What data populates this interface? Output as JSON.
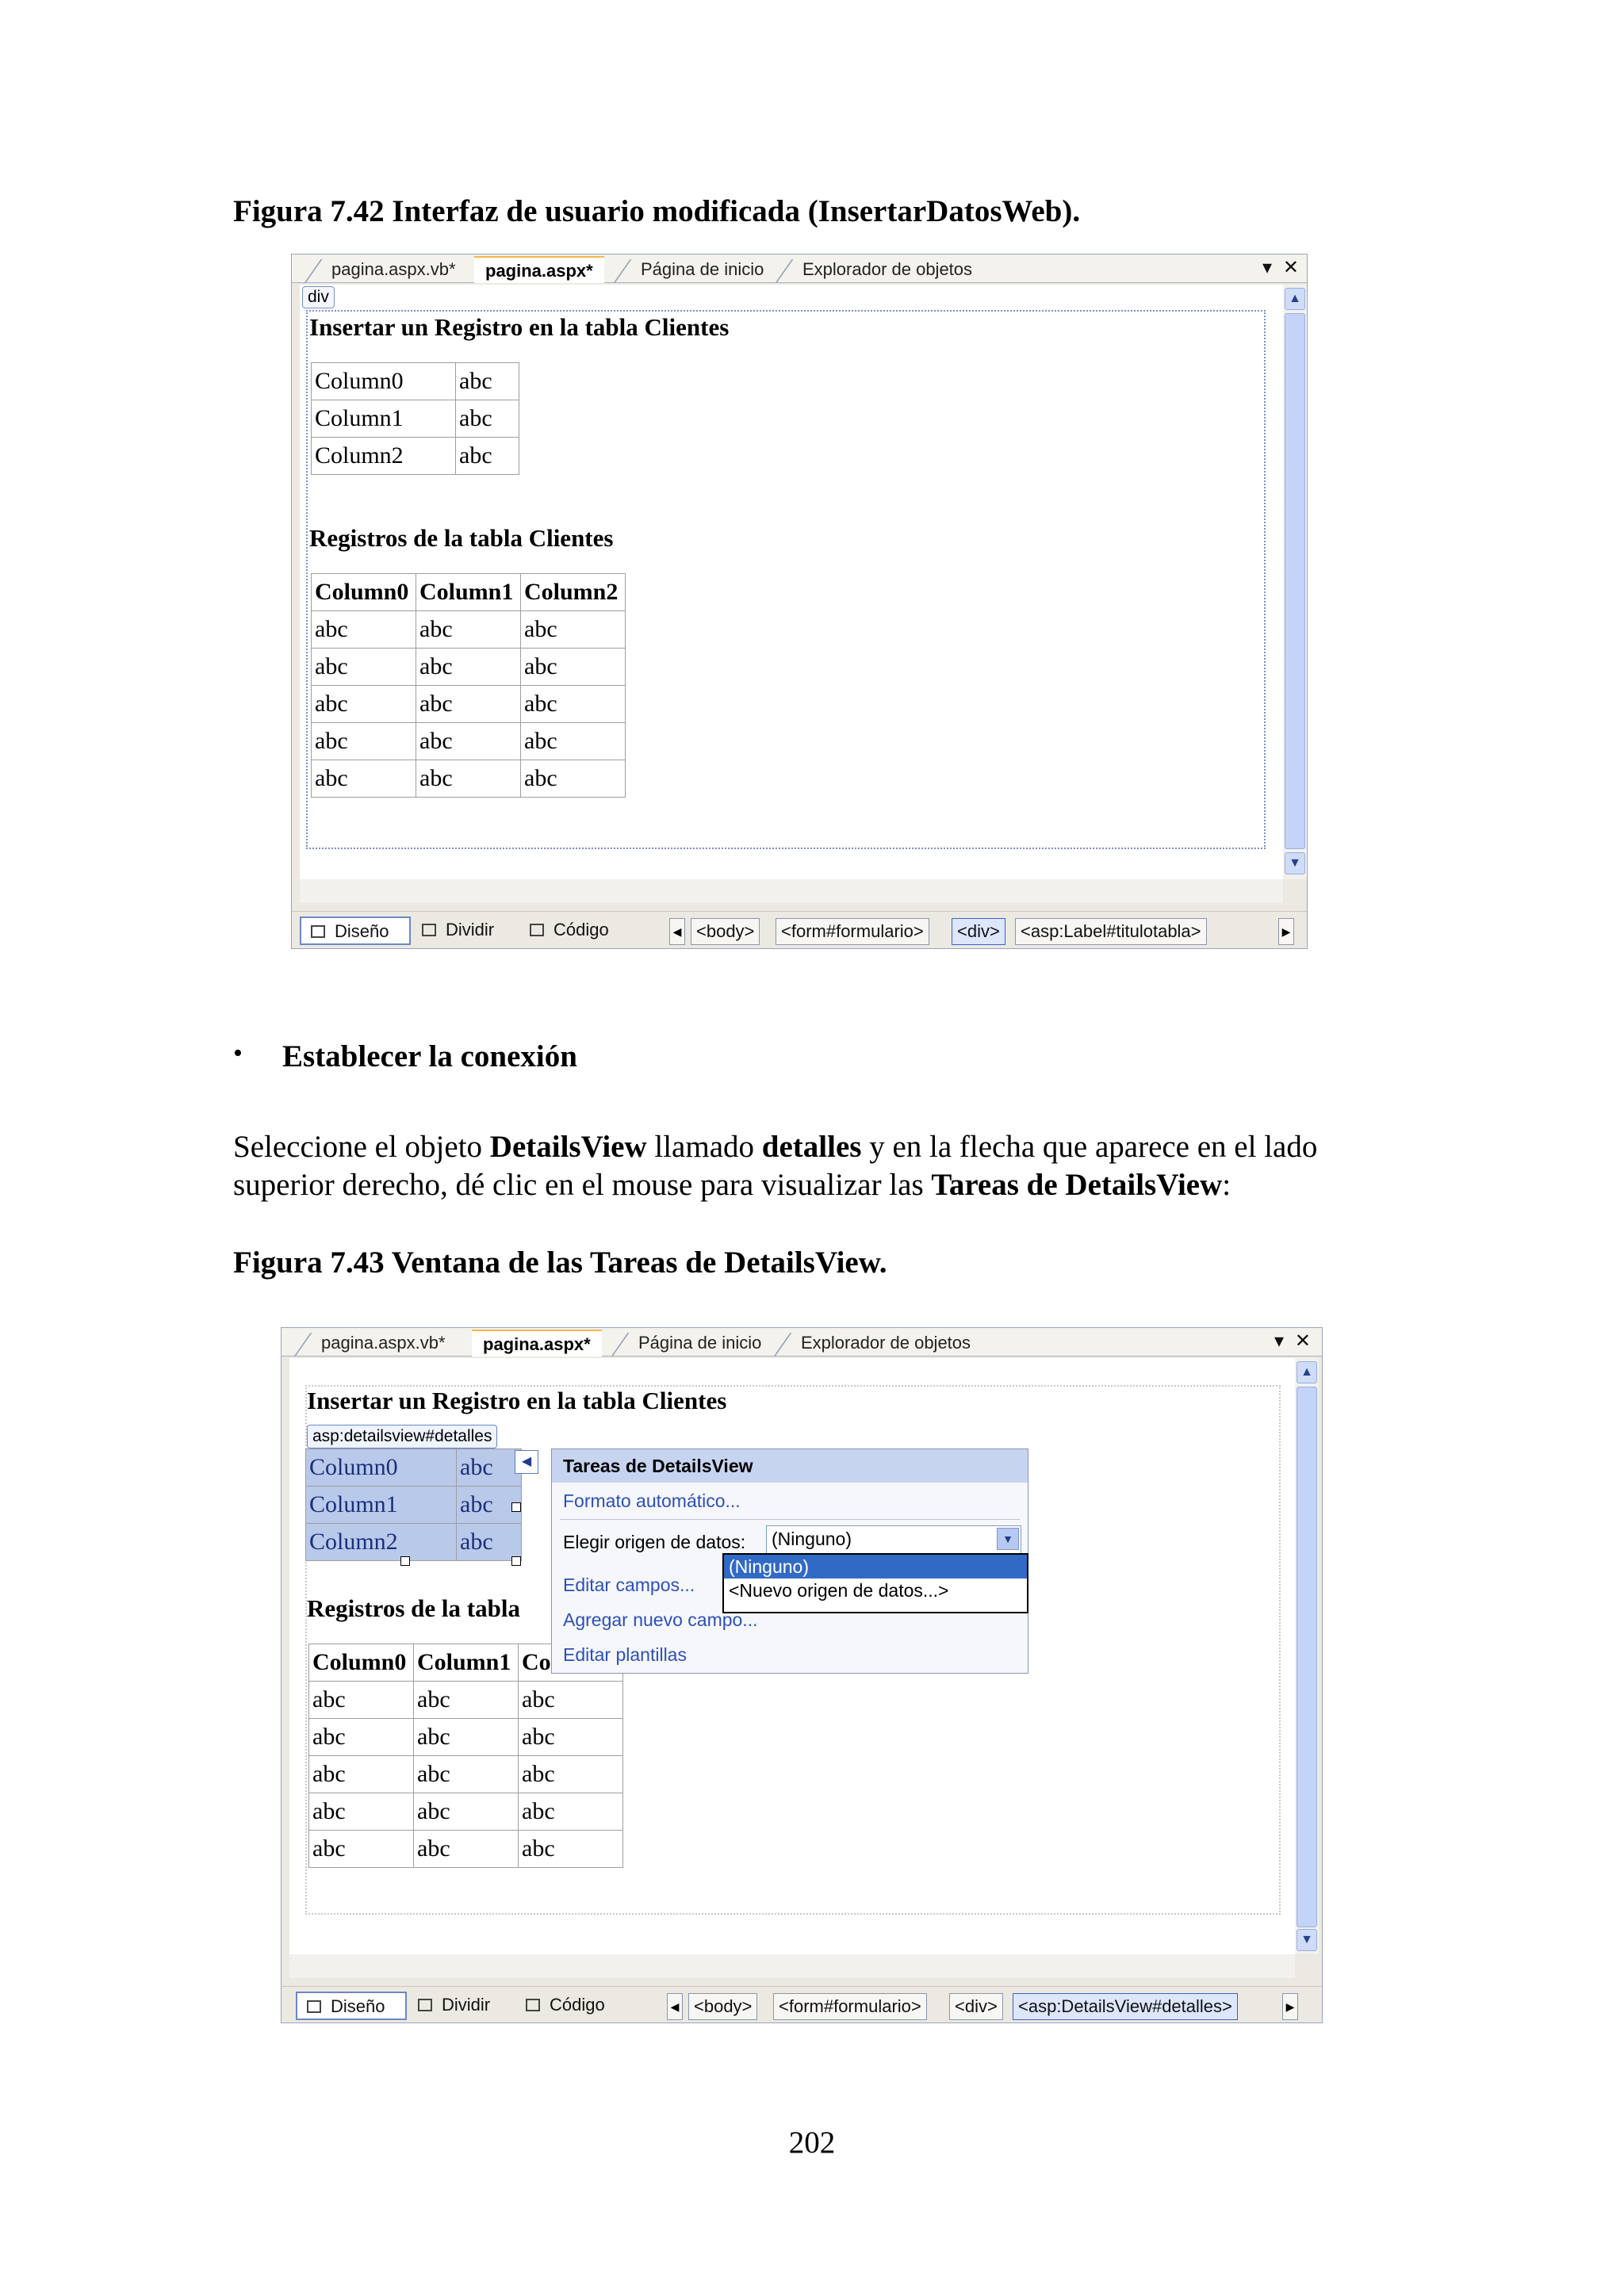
{
  "figure1": {
    "caption": "Figura 7.42 Interfaz de usuario modificada (InsertarDatosWeb).",
    "window": {
      "tabs": [
        "pagina.aspx.vb*",
        "pagina.aspx*",
        "Página de inicio",
        "Explorador de objetos"
      ],
      "active_tab_index": 1,
      "tab_controls": {
        "dropdown": "▾",
        "close": "✕"
      },
      "div_tag": "div",
      "heading1": "Insertar un Registro en la tabla Clientes",
      "details_rows": [
        [
          "Column0",
          "abc"
        ],
        [
          "Column1",
          "abc"
        ],
        [
          "Column2",
          "abc"
        ]
      ],
      "heading2": "Registros de la tabla Clientes",
      "grid_headers": [
        "Column0",
        "Column1",
        "Column2"
      ],
      "grid_rows": [
        [
          "abc",
          "abc",
          "abc"
        ],
        [
          "abc",
          "abc",
          "abc"
        ],
        [
          "abc",
          "abc",
          "abc"
        ],
        [
          "abc",
          "abc",
          "abc"
        ],
        [
          "abc",
          "abc",
          "abc"
        ]
      ],
      "status_buttons": [
        "Diseño",
        "Dividir",
        "Código"
      ],
      "active_view": "Diseño",
      "breadcrumbs": [
        "<body>",
        "<form#formulario>",
        "<div>",
        "<asp:Label#titulotabla>"
      ],
      "selected_crumb_index": 2
    }
  },
  "bullet": {
    "symbol": "•",
    "text": "Establecer la conexión"
  },
  "paragraph": {
    "line1": [
      {
        "text": "Seleccione el objeto ",
        "bold": false
      },
      {
        "text": "DetailsView",
        "bold": true
      },
      {
        "text": " llamado ",
        "bold": false
      },
      {
        "text": "detalles",
        "bold": true
      },
      {
        "text": " y en la flecha que aparece en el lado",
        "bold": false
      }
    ],
    "line2": [
      {
        "text": "superior derecho, dé clic en el mouse para visualizar las ",
        "bold": false
      },
      {
        "text": "Tareas de DetailsView",
        "bold": true
      },
      {
        "text": ":",
        "bold": false
      }
    ]
  },
  "figure2": {
    "caption": "Figura 7.43 Ventana de las Tareas de DetailsView.",
    "window": {
      "tabs": [
        "pagina.aspx.vb*",
        "pagina.aspx*",
        "Página de inicio",
        "Explorador de objetos"
      ],
      "active_tab_index": 1,
      "tab_controls": {
        "dropdown": "▾",
        "close": "✕"
      },
      "heading1": "Insertar un Registro en la tabla Clientes",
      "control_tag": "asp:detailsview#detalles",
      "details_rows": [
        [
          "Column0",
          "abc"
        ],
        [
          "Column1",
          "abc"
        ],
        [
          "Column2",
          "abc"
        ]
      ],
      "heading2": "Registros de la tabla",
      "grid_headers": [
        "Column0",
        "Column1",
        "Column2"
      ],
      "grid_rows": [
        [
          "abc",
          "abc",
          "abc"
        ],
        [
          "abc",
          "abc",
          "abc"
        ],
        [
          "abc",
          "abc",
          "abc"
        ],
        [
          "abc",
          "abc",
          "abc"
        ],
        [
          "abc",
          "abc",
          "abc"
        ]
      ],
      "smart_tag": {
        "title": "Tareas de DetailsView",
        "auto_format": "Formato automático...",
        "data_source_label": "Elegir origen de datos:",
        "data_source_value": "(Ninguno)",
        "dropdown_options": [
          "(Ninguno)",
          "<Nuevo origen de datos...>"
        ],
        "selected_option_index": 0,
        "edit_fields": "Editar campos...",
        "add_field": "Agregar nuevo campo...",
        "edit_templates": "Editar plantillas"
      },
      "status_buttons": [
        "Diseño",
        "Dividir",
        "Código"
      ],
      "active_view": "Diseño",
      "breadcrumbs": [
        "<body>",
        "<form#formulario>",
        "<div>",
        "<asp:DetailsView#detalles>"
      ],
      "selected_crumb_index": 3
    }
  },
  "page_number": "202"
}
